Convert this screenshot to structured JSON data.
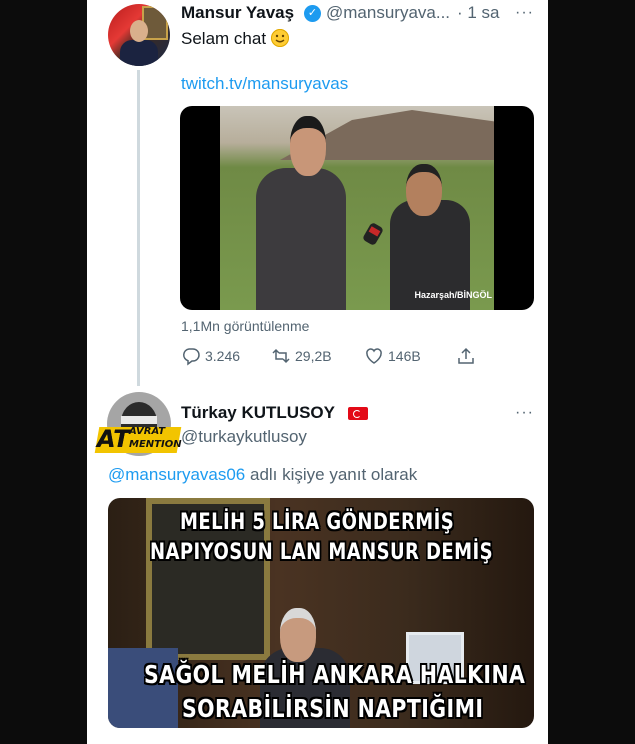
{
  "tweet1": {
    "display_name": "Mansur Yavaş",
    "handle": "@mansuryava...",
    "time": "· 1 sa",
    "more": "···",
    "text": "Selam chat",
    "link": "twitch.tv/mansuryavas",
    "video_watermark": "Hazarşah/BİNGÖL",
    "views": "1,1Mn görüntülenme",
    "actions": {
      "replies": "3.246",
      "retweets": "29,2B",
      "likes": "146B"
    }
  },
  "tweet2": {
    "display_name": "Türkay KUTLUSOY",
    "handle": "@turkaykutlusoy",
    "more": "···",
    "reply_to_mention": "@mansuryavas06",
    "reply_to_suffix": " adlı kişiye yanıt olarak",
    "avatar_badge": {
      "big": "AT",
      "top": "AVRAT",
      "bottom": "MENTION"
    },
    "meme_lines": [
      "MELİH 5 LİRA GÖNDERMİŞ",
      "NAPIYOSUN LAN MANSUR DEMİŞ",
      "SAĞOL MELİH ANKARA HALKINA",
      "SORABİLİRSİN NAPTIĞIMI"
    ]
  },
  "colors": {
    "background": "#0c0c0c",
    "panel": "#ffffff",
    "link": "#1d9bf0",
    "secondary_text": "#536471",
    "primary_text": "#0f1419"
  }
}
